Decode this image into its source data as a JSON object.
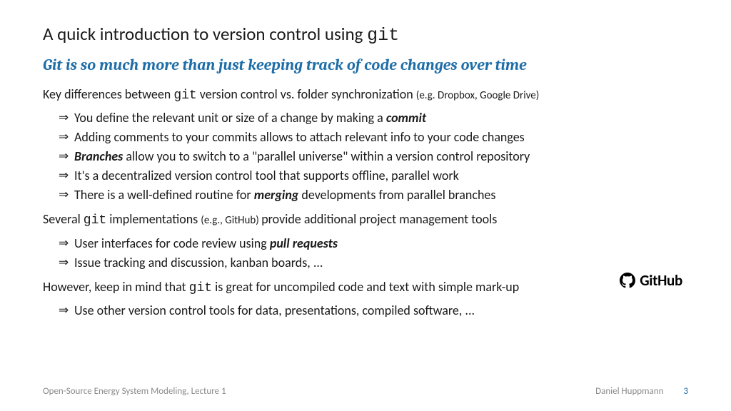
{
  "title_prefix": "A quick introduction to version control using ",
  "title_code": "git",
  "subhead": "Git is so much more than just keeping track of code changes over time",
  "intro_prefix": "Key differences between ",
  "intro_code": "git",
  "intro_mid": " version control vs. folder synchronization ",
  "intro_small": "(e.g. Dropbox, Google Drive)",
  "bullets1": {
    "b0_a": "You define the relevant unit or size of a change by making a ",
    "b0_em": "commit",
    "b1": "Adding comments to your commits allows to attach relevant info to your code changes",
    "b2_em": "Branches",
    "b2_b": " allow you to switch to a \"parallel universe\" within a version control repository",
    "b3": "It's a decentralized version control tool that supports offline, parallel work",
    "b4_a": "There is a well-defined routine for ",
    "b4_em": "merging",
    "b4_b": " developments from parallel branches"
  },
  "impl_prefix": "Several ",
  "impl_code": "git",
  "impl_mid": " implementations ",
  "impl_small": "(e.g., GitHub) ",
  "impl_suffix": "provide additional project management tools",
  "bullets2": {
    "b0_a": "User interfaces for code review using ",
    "b0_em": "pull requests",
    "b1": "Issue tracking and discussion, kanban boards, ..."
  },
  "however_prefix": "However, keep in mind that ",
  "however_code": "git",
  "however_suffix": " is great for uncompiled code and text with simple mark-up",
  "bullets3": {
    "b0": "Use other version control tools for data, presentations, compiled software, ..."
  },
  "github_label": "GitHub",
  "footer": {
    "left": "Open-Source Energy System Modeling, Lecture 1",
    "author": "Daniel Huppmann",
    "page": "3"
  },
  "arrow": "⇒"
}
